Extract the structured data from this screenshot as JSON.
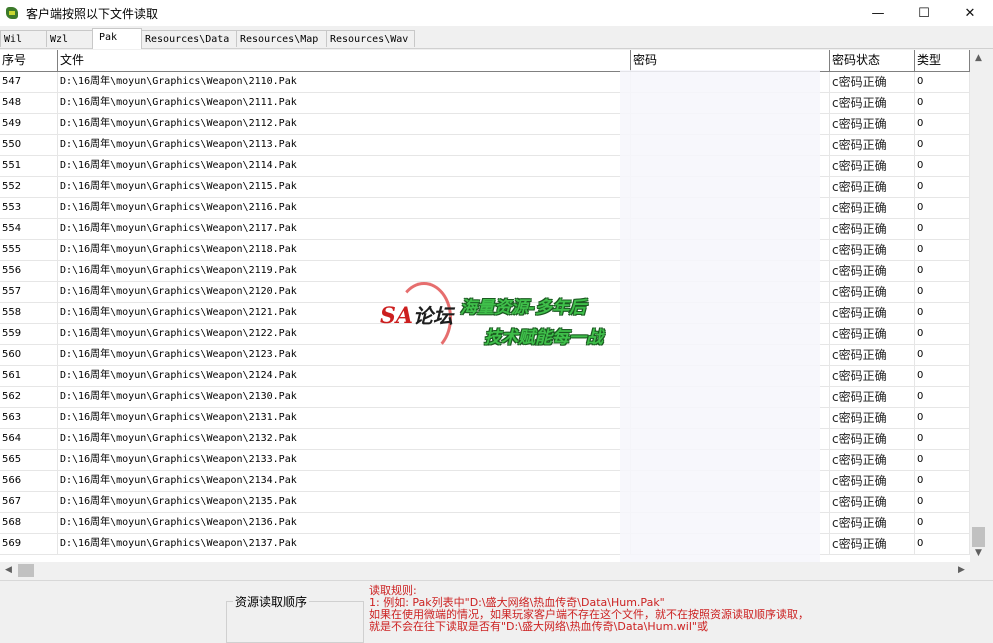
{
  "window": {
    "title": "客户端按照以下文件读取",
    "minimize_glyph": "—",
    "maximize_glyph": "☐",
    "close_glyph": "✕"
  },
  "tabs": [
    {
      "label": "Wil",
      "active": false
    },
    {
      "label": "Wzl",
      "active": false
    },
    {
      "label": "Pak",
      "active": true
    },
    {
      "label": "Resources\\Data",
      "active": false
    },
    {
      "label": "Resources\\Map",
      "active": false
    },
    {
      "label": "Resources\\Wav",
      "active": false
    }
  ],
  "grid": {
    "columns": [
      "序号",
      "文件",
      "密码",
      "密码状态",
      "类型"
    ],
    "rows": [
      {
        "id": "547",
        "file_pre": "D:\\16",
        "file_zh": "周年",
        "file_post": "\\moyun\\Graphics\\Weapon\\2110.Pak",
        "status": "c密码正确",
        "type": "0"
      },
      {
        "id": "548",
        "file_pre": "D:\\16",
        "file_zh": "周年",
        "file_post": "\\moyun\\Graphics\\Weapon\\2111.Pak",
        "status": "c密码正确",
        "type": "0"
      },
      {
        "id": "549",
        "file_pre": "D:\\16",
        "file_zh": "周年",
        "file_post": "\\moyun\\Graphics\\Weapon\\2112.Pak",
        "status": "c密码正确",
        "type": "0"
      },
      {
        "id": "550",
        "file_pre": "D:\\16",
        "file_zh": "周年",
        "file_post": "\\moyun\\Graphics\\Weapon\\2113.Pak",
        "status": "c密码正确",
        "type": "0"
      },
      {
        "id": "551",
        "file_pre": "D:\\16",
        "file_zh": "周年",
        "file_post": "\\moyun\\Graphics\\Weapon\\2114.Pak",
        "status": "c密码正确",
        "type": "0"
      },
      {
        "id": "552",
        "file_pre": "D:\\16",
        "file_zh": "周年",
        "file_post": "\\moyun\\Graphics\\Weapon\\2115.Pak",
        "status": "c密码正确",
        "type": "0"
      },
      {
        "id": "553",
        "file_pre": "D:\\16",
        "file_zh": "周年",
        "file_post": "\\moyun\\Graphics\\Weapon\\2116.Pak",
        "status": "c密码正确",
        "type": "0"
      },
      {
        "id": "554",
        "file_pre": "D:\\16",
        "file_zh": "周年",
        "file_post": "\\moyun\\Graphics\\Weapon\\2117.Pak",
        "status": "c密码正确",
        "type": "0"
      },
      {
        "id": "555",
        "file_pre": "D:\\16",
        "file_zh": "周年",
        "file_post": "\\moyun\\Graphics\\Weapon\\2118.Pak",
        "status": "c密码正确",
        "type": "0"
      },
      {
        "id": "556",
        "file_pre": "D:\\16",
        "file_zh": "周年",
        "file_post": "\\moyun\\Graphics\\Weapon\\2119.Pak",
        "status": "c密码正确",
        "type": "0"
      },
      {
        "id": "557",
        "file_pre": "D:\\16",
        "file_zh": "周年",
        "file_post": "\\moyun\\Graphics\\Weapon\\2120.Pak",
        "status": "c密码正确",
        "type": "0"
      },
      {
        "id": "558",
        "file_pre": "D:\\16",
        "file_zh": "周年",
        "file_post": "\\moyun\\Graphics\\Weapon\\2121.Pak",
        "status": "c密码正确",
        "type": "0"
      },
      {
        "id": "559",
        "file_pre": "D:\\16",
        "file_zh": "周年",
        "file_post": "\\moyun\\Graphics\\Weapon\\2122.Pak",
        "status": "c密码正确",
        "type": "0"
      },
      {
        "id": "560",
        "file_pre": "D:\\16",
        "file_zh": "周年",
        "file_post": "\\moyun\\Graphics\\Weapon\\2123.Pak",
        "status": "c密码正确",
        "type": "0"
      },
      {
        "id": "561",
        "file_pre": "D:\\16",
        "file_zh": "周年",
        "file_post": "\\moyun\\Graphics\\Weapon\\2124.Pak",
        "status": "c密码正确",
        "type": "0"
      },
      {
        "id": "562",
        "file_pre": "D:\\16",
        "file_zh": "周年",
        "file_post": "\\moyun\\Graphics\\Weapon\\2130.Pak",
        "status": "c密码正确",
        "type": "0"
      },
      {
        "id": "563",
        "file_pre": "D:\\16",
        "file_zh": "周年",
        "file_post": "\\moyun\\Graphics\\Weapon\\2131.Pak",
        "status": "c密码正确",
        "type": "0"
      },
      {
        "id": "564",
        "file_pre": "D:\\16",
        "file_zh": "周年",
        "file_post": "\\moyun\\Graphics\\Weapon\\2132.Pak",
        "status": "c密码正确",
        "type": "0"
      },
      {
        "id": "565",
        "file_pre": "D:\\16",
        "file_zh": "周年",
        "file_post": "\\moyun\\Graphics\\Weapon\\2133.Pak",
        "status": "c密码正确",
        "type": "0"
      },
      {
        "id": "566",
        "file_pre": "D:\\16",
        "file_zh": "周年",
        "file_post": "\\moyun\\Graphics\\Weapon\\2134.Pak",
        "status": "c密码正确",
        "type": "0"
      },
      {
        "id": "567",
        "file_pre": "D:\\16",
        "file_zh": "周年",
        "file_post": "\\moyun\\Graphics\\Weapon\\2135.Pak",
        "status": "c密码正确",
        "type": "0"
      },
      {
        "id": "568",
        "file_pre": "D:\\16",
        "file_zh": "周年",
        "file_post": "\\moyun\\Graphics\\Weapon\\2136.Pak",
        "status": "c密码正确",
        "type": "0"
      },
      {
        "id": "569",
        "file_pre": "D:\\16",
        "file_zh": "周年",
        "file_post": "\\moyun\\Graphics\\Weapon\\2137.Pak",
        "status": "c密码正确",
        "type": "0"
      }
    ]
  },
  "bottom": {
    "group_label": "资源读取顺序",
    "rules_title": "读取规则:",
    "rules_lines": [
      "1: 例如: Pak列表中\"D:\\盛大网络\\热血传奇\\Data\\Hum.Pak\"",
      "    如果在使用微端的情况，如果玩家客户端不存在这个文件，就不在按照资源读取顺序读取，",
      "    就是不会在往下读取是否有\"D:\\盛大网络\\热血传奇\\Data\\Hum.wil\"或"
    ]
  },
  "watermark": {
    "logo": "SA",
    "logo_sub": "论坛",
    "line1": "海量资源-多年后",
    "line2": "技术赋能每一战"
  },
  "icons": {
    "scroll_up": "▲",
    "scroll_down": "▼",
    "scroll_left": "◀",
    "scroll_right": "▶"
  }
}
